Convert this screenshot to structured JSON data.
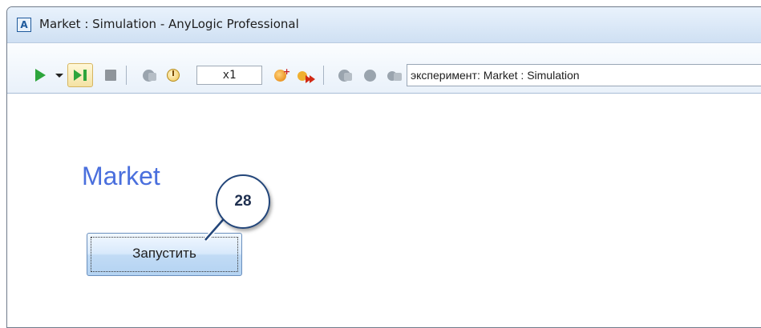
{
  "window": {
    "title": "Market : Simulation - AnyLogic Professional",
    "app_icon_letter": "A"
  },
  "toolbar": {
    "speed_value": "x1",
    "experiment_select_value": "эксперимент: Market : Simulation",
    "icons": [
      "play-icon",
      "dropdown-arrow-icon",
      "step-icon",
      "stop-icon",
      "pause-icon",
      "clock-icon",
      "speed-up-icon",
      "fast-forward-icon",
      "navigate-up-icon",
      "navigate-icon",
      "window-icon"
    ]
  },
  "content": {
    "heading": "Market",
    "run_button_label": "Запустить",
    "callout_number": "28"
  },
  "colors": {
    "heading": "#4a6fdd",
    "play_green": "#2da53c",
    "callout_border": "#23467a"
  }
}
